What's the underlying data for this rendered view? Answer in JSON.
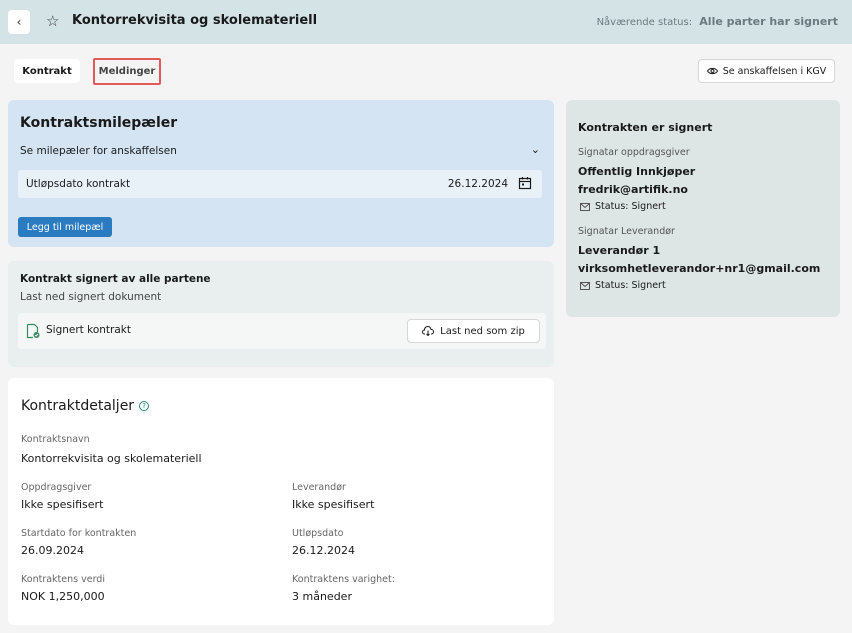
{
  "header": {
    "back_glyph": "‹",
    "star_glyph": "☆",
    "title": "Kontorrekvisita og skolemateriell",
    "status_label": "Nåværende status:",
    "status_value": "Alle parter har signert"
  },
  "tabs": [
    {
      "label": "Kontrakt"
    },
    {
      "label": "Meldinger"
    }
  ],
  "toolbar": {
    "kgv_label": "Se anskaffelsen i KGV",
    "kgv_icon": "eye-icon"
  },
  "milestones": {
    "title": "Kontraktsmilepæler",
    "subtitle": "Se milepæler for anskaffelsen",
    "chevron_glyph": "⌄",
    "row_label": "Utløpsdato kontrakt",
    "row_date": "26.12.2024",
    "add_button": "Legg til milepæl"
  },
  "signed": {
    "title": "Kontrakt signert av alle partene",
    "subtitle": "Last ned signert dokument",
    "doc_label": "Signert kontrakt",
    "zip_button": "Last ned som zip"
  },
  "details": {
    "title": "Kontraktdetaljer",
    "help_glyph": "?",
    "fields": {
      "name_label": "Kontraktsnavn",
      "name_value": "Kontorrekvisita og skolemateriell",
      "client_label": "Oppdragsgiver",
      "client_value": "Ikke spesifisert",
      "supplier_label": "Leverandør",
      "supplier_value": "Ikke spesifisert",
      "start_label": "Startdato for kontrakten",
      "start_value": "26.09.2024",
      "expiry_label": "Utløpsdato",
      "expiry_value": "26.12.2024",
      "value_label": "Kontraktens verdi",
      "value_value": "NOK 1,250,000",
      "duration_label": "Kontraktens varighet:",
      "duration_value": "3 måneder"
    }
  },
  "sign_panel": {
    "title": "Kontrakten er signert",
    "client_sig_label": "Signatar oppdragsgiver",
    "client_name": "Offentlig Innkjøper",
    "client_email": "fredrik@artifik.no",
    "client_status": "Status: Signert",
    "supplier_sig_label": "Signatar Leverandør",
    "supplier_name": "Leverandør 1",
    "supplier_email": "virksomhetleverandor+nr1@gmail.com",
    "supplier_status": "Status: Signert"
  },
  "colors": {
    "header_bg": "#d3e3e6",
    "milestone_bg": "#d4e4f3",
    "primary_button": "#2a7bbf",
    "highlight_border": "#e05a5a",
    "signed_panel_bg": "#dde6e4"
  }
}
